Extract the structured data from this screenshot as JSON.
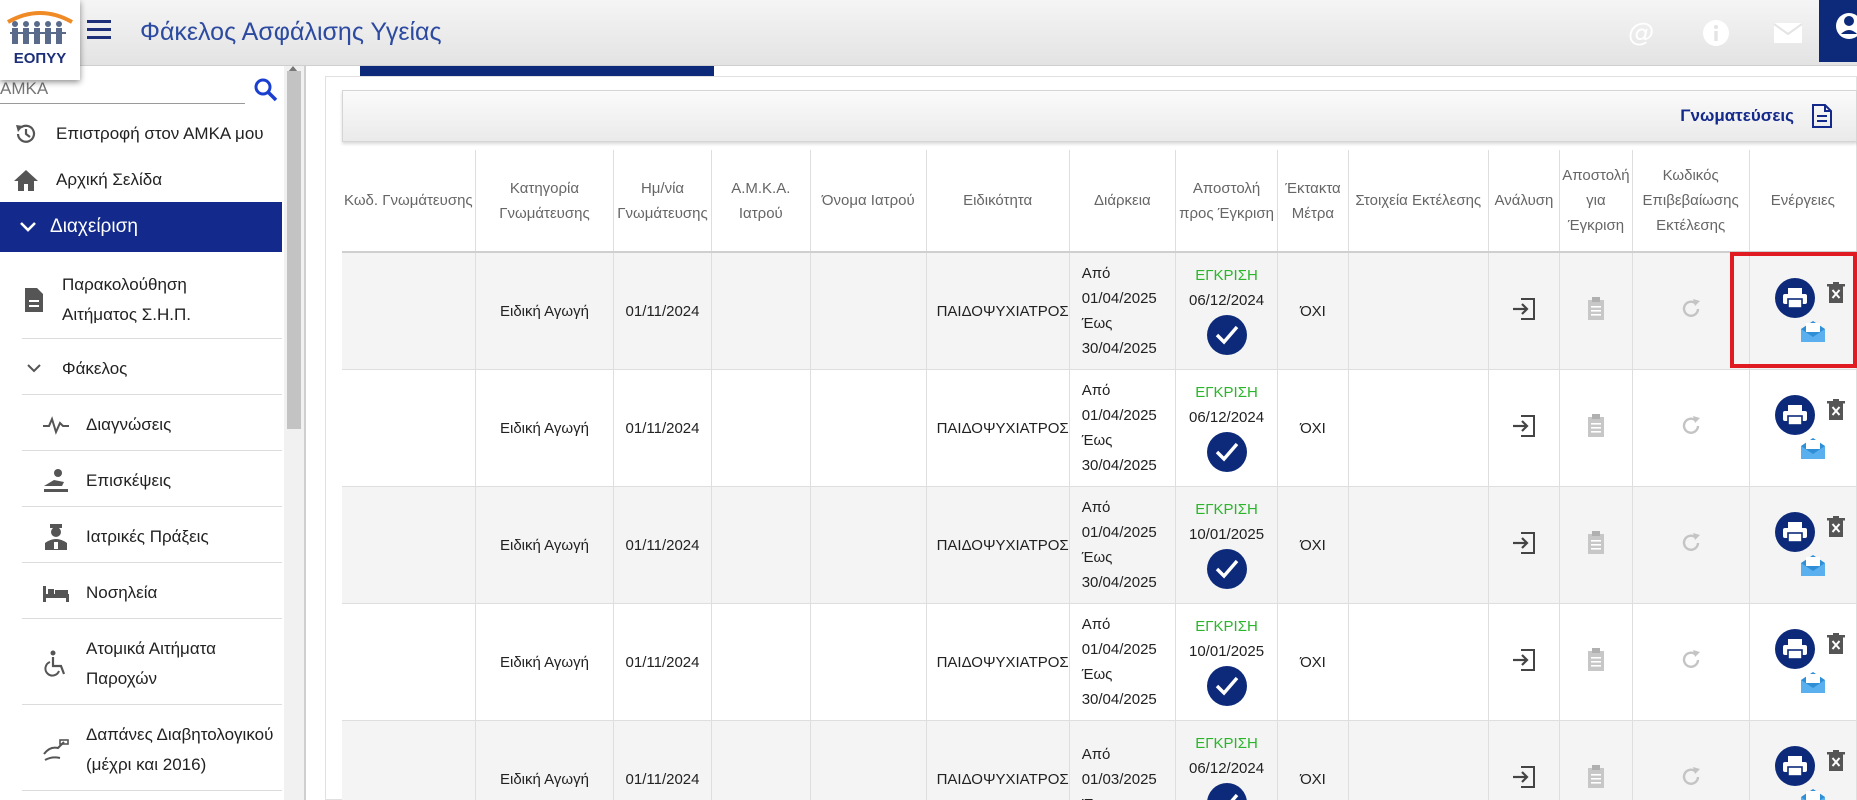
{
  "header": {
    "logo_text": "ΕΟΠΥΥ",
    "title": "Φάκελος Ασφάλισης Υγείας",
    "icons": [
      "at-icon",
      "info-icon",
      "mail-icon",
      "user-icon"
    ]
  },
  "sidebar": {
    "search_placeholder": "ΑΜΚΑ",
    "items": [
      {
        "label": "Επιστροφή στον ΑΜΚΑ μου",
        "icon": "history-icon"
      },
      {
        "label": "Αρχική Σελίδα",
        "icon": "home-icon"
      },
      {
        "label": "Διαχείριση",
        "icon": "chevron-down-icon",
        "active": true
      },
      {
        "label": "Παρακολούθηση Αιτήματος Σ.Η.Π.",
        "icon": "document-icon"
      },
      {
        "label": "Φάκελος",
        "icon": "chevron-down-icon"
      },
      {
        "label": "Διαγνώσεις",
        "icon": "pulse-icon"
      },
      {
        "label": "Επισκέψεις",
        "icon": "visit-icon"
      },
      {
        "label": "Ιατρικές Πράξεις",
        "icon": "doctor-icon"
      },
      {
        "label": "Νοσηλεία",
        "icon": "bed-icon"
      },
      {
        "label": "Ατομικά Αιτήματα Παροχών",
        "icon": "wheelchair-icon"
      },
      {
        "label": "Δαπάνες Διαβητολογικού (μέχρι και 2016)",
        "icon": "diabetes-icon"
      }
    ]
  },
  "panel": {
    "title": "Γνωματεύσεις"
  },
  "table": {
    "columns": [
      "Κωδ. Γνωμάτευσης",
      "Κατηγορία Γνωμάτευσης",
      "Ημ/νία Γνωμάτευσης",
      "Α.Μ.Κ.Α. Ιατρού",
      "Όνομα Ιατρού",
      "Ειδικότητα",
      "Διάρκεια",
      "Αποστολή προς Έγκριση",
      "Έκτακτα Μέτρα",
      "Στοιχεία Εκτέλεσης",
      "Ανάλυση",
      "Αποστολή για Έγκριση",
      "Κωδικός Επιβεβαίωσης Εκτέλεσης",
      "Ενέργειες"
    ],
    "rows": [
      {
        "category": "Ειδική Αγωγή",
        "date": "01/11/2024",
        "specialty": "ΠΑΙΔΟΨΥΧΙΑΤΡΟΣ",
        "from_label": "Από",
        "from": "01/04/2025",
        "to_label": "Έως",
        "to": "30/04/2025",
        "status": "ΕΓΚΡΙΣΗ",
        "status_date": "06/12/2024",
        "emergency": "ΌΧΙ"
      },
      {
        "category": "Ειδική Αγωγή",
        "date": "01/11/2024",
        "specialty": "ΠΑΙΔΟΨΥΧΙΑΤΡΟΣ",
        "from_label": "Από",
        "from": "01/04/2025",
        "to_label": "Έως",
        "to": "30/04/2025",
        "status": "ΕΓΚΡΙΣΗ",
        "status_date": "06/12/2024",
        "emergency": "ΌΧΙ"
      },
      {
        "category": "Ειδική Αγωγή",
        "date": "01/11/2024",
        "specialty": "ΠΑΙΔΟΨΥΧΙΑΤΡΟΣ",
        "from_label": "Από",
        "from": "01/04/2025",
        "to_label": "Έως",
        "to": "30/04/2025",
        "status": "ΕΓΚΡΙΣΗ",
        "status_date": "10/01/2025",
        "emergency": "ΌΧΙ"
      },
      {
        "category": "Ειδική Αγωγή",
        "date": "01/11/2024",
        "specialty": "ΠΑΙΔΟΨΥΧΙΑΤΡΟΣ",
        "from_label": "Από",
        "from": "01/04/2025",
        "to_label": "Έως",
        "to": "30/04/2025",
        "status": "ΕΓΚΡΙΣΗ",
        "status_date": "10/01/2025",
        "emergency": "ΌΧΙ"
      },
      {
        "category": "Ειδική Αγωγή",
        "date": "01/11/2024",
        "specialty": "ΠΑΙΔΟΨΥΧΙΑΤΡΟΣ",
        "from_label": "Από",
        "from": "01/03/2025",
        "to_label": "Έως",
        "to": "",
        "status": "ΕΓΚΡΙΣΗ",
        "status_date": "06/12/2024",
        "emergency": "ΌΧΙ"
      }
    ]
  },
  "colors": {
    "brand_blue": "#13298b",
    "dark_blue": "#0d2a7a",
    "approved_green": "#2bb52b",
    "highlight_red": "#e11b22"
  }
}
